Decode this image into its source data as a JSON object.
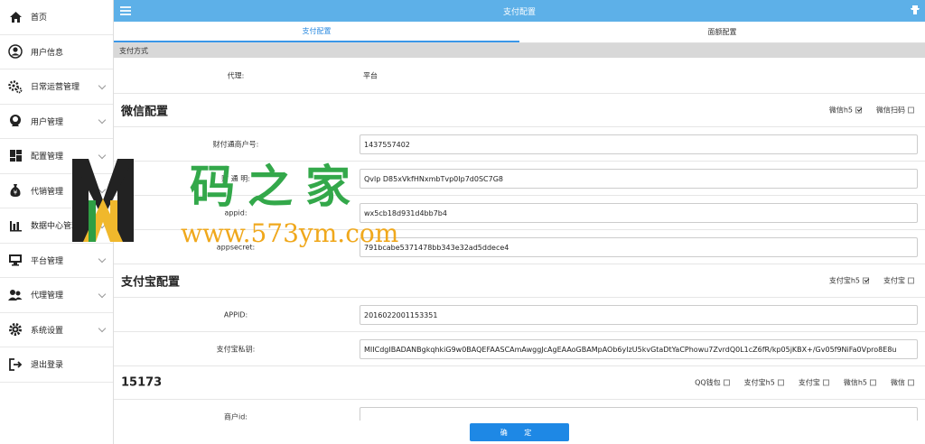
{
  "sidebar": {
    "items": [
      {
        "label": "首页",
        "icon": "home-icon"
      },
      {
        "label": "用户信息",
        "icon": "user-circle-icon"
      },
      {
        "label": "日常运营管理",
        "icon": "gears-icon"
      },
      {
        "label": "用户管理",
        "icon": "user-icon"
      },
      {
        "label": "配置管理",
        "icon": "dashboard-icon"
      },
      {
        "label": "代销管理",
        "icon": "money-bag-icon"
      },
      {
        "label": "数据中心管理",
        "icon": "bar-chart-icon"
      },
      {
        "label": "平台管理",
        "icon": "monitor-icon"
      },
      {
        "label": "代理管理",
        "icon": "users-icon"
      },
      {
        "label": "系统设置",
        "icon": "gear-icon"
      },
      {
        "label": "退出登录",
        "icon": "logout-icon"
      }
    ]
  },
  "header": {
    "title": "支付配置"
  },
  "tabs": [
    {
      "label": "支付配置",
      "active": true
    },
    {
      "label": "面额配置",
      "active": false
    }
  ],
  "payment_method": {
    "section_label": "支付方式",
    "agent_label": "代理:",
    "agent_value": "平台"
  },
  "wechat": {
    "title": "微信配置",
    "options": [
      {
        "label": "微信h5",
        "checked": true
      },
      {
        "label": "微信扫码",
        "checked": false
      }
    ],
    "fields": [
      {
        "label": "财付通商户号:",
        "value": "1437557402"
      },
      {
        "label": "财    通    明:",
        "value": "Qvlp    D85xVkfHNxmbTvp0Ip7d0SC7G8"
      },
      {
        "label": "appid:",
        "value": "wx5cb18d931d4bb7b4"
      },
      {
        "label": "appsecret:",
        "value": "791bcabe5371478bb343e32ad5ddece4"
      }
    ]
  },
  "alipay": {
    "title": "支付宝配置",
    "options": [
      {
        "label": "支付宝h5",
        "checked": true
      },
      {
        "label": "支付宝",
        "checked": false
      }
    ],
    "fields": [
      {
        "label": "APPID:",
        "value": "2016022001153351"
      },
      {
        "label": "支付宝私钥:",
        "value": "MIICdgIBADANBgkqhkiG9w0BAQEFAASCAmAwggJcAgEAAoGBAMpAOb6yIzU5kvGtaDtYaCPhowu7ZvrdQ0L1cZ6fR/kp05jKBX+/Gv05f9NiFa0Vpro8E8u"
      }
    ]
  },
  "group_15173": {
    "title": "15173",
    "options": [
      {
        "label": "QQ钱包",
        "checked": false
      },
      {
        "label": "支付宝h5",
        "checked": false
      },
      {
        "label": "支付宝",
        "checked": false
      },
      {
        "label": "微信h5",
        "checked": false
      },
      {
        "label": "微信",
        "checked": false
      }
    ],
    "fields": [
      {
        "label": "商户id:",
        "value": ""
      }
    ]
  },
  "confirm_label": "确 定",
  "watermark": {
    "site_name": "码之家",
    "url": "www.573ym.com"
  },
  "colors": {
    "topbar": "#5db0e8",
    "accent": "#1e88e5",
    "tab_active": "#2b8ae0"
  }
}
